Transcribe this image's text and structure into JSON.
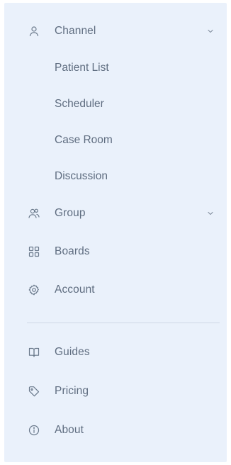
{
  "nav": {
    "channel": {
      "label": "Channel",
      "icon": "user-icon",
      "expanded": true,
      "children": [
        "Patient List",
        "Scheduler",
        "Case Room",
        "Discussion"
      ]
    },
    "group": {
      "label": "Group",
      "icon": "users-icon",
      "expanded": false
    },
    "boards": {
      "label": "Boards",
      "icon": "grid-icon"
    },
    "account": {
      "label": "Account",
      "icon": "gear-icon"
    }
  },
  "secondary": {
    "guides": {
      "label": "Guides",
      "icon": "book-open-icon"
    },
    "pricing": {
      "label": "Pricing",
      "icon": "tag-icon"
    },
    "about": {
      "label": "About",
      "icon": "info-icon"
    }
  },
  "colors": {
    "background": "#eaf1fb",
    "text": "#5f6d80",
    "divider": "#cfd8e5"
  }
}
